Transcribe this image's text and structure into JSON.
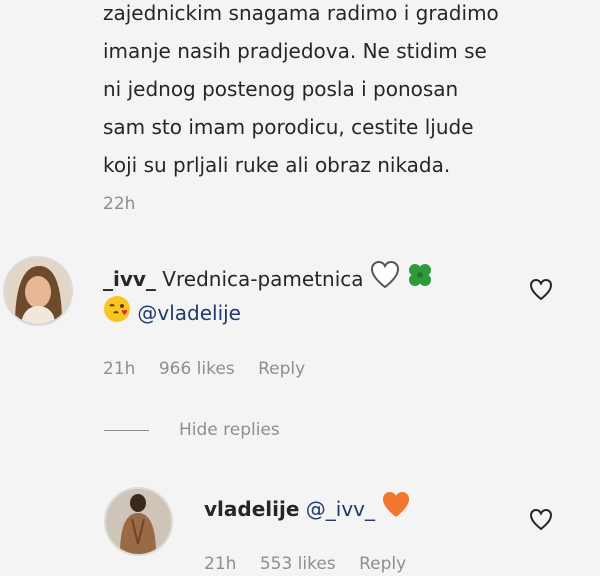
{
  "previous_comment": {
    "text": "zajednickim snagama radimo i gradimo\nimanje nasih pradjedova. Ne stidim se\nni jednog postenog posla i ponosan\nsam sto imam porodicu, cestite ljude\nkoji su prljali ruke ali obraz nikada.",
    "time": "22h"
  },
  "comment": {
    "username": "_ivv_",
    "text": "Vrednica-pametnica",
    "mention": "@vladelije",
    "time": "21h",
    "likes": "966 likes",
    "reply": "Reply"
  },
  "hide_replies": "Hide replies",
  "reply_comment": {
    "username": "vladelije",
    "mention": "@_ivv_",
    "time": "21h",
    "likes": "553 likes",
    "reply": "Reply"
  },
  "icons": {
    "heart": "white-heart-icon",
    "clover": "four-leaf-clover-icon",
    "wink": "winking-kiss-face-icon",
    "orange_heart": "orange-heart-icon",
    "like": "like-heart-outline-icon"
  },
  "colors": {
    "text": "#262626",
    "secondary": "#8e8e8e",
    "mention": "#1f3a6b",
    "clover": "#2e9b3a",
    "orange_heart": "#f2762e"
  }
}
